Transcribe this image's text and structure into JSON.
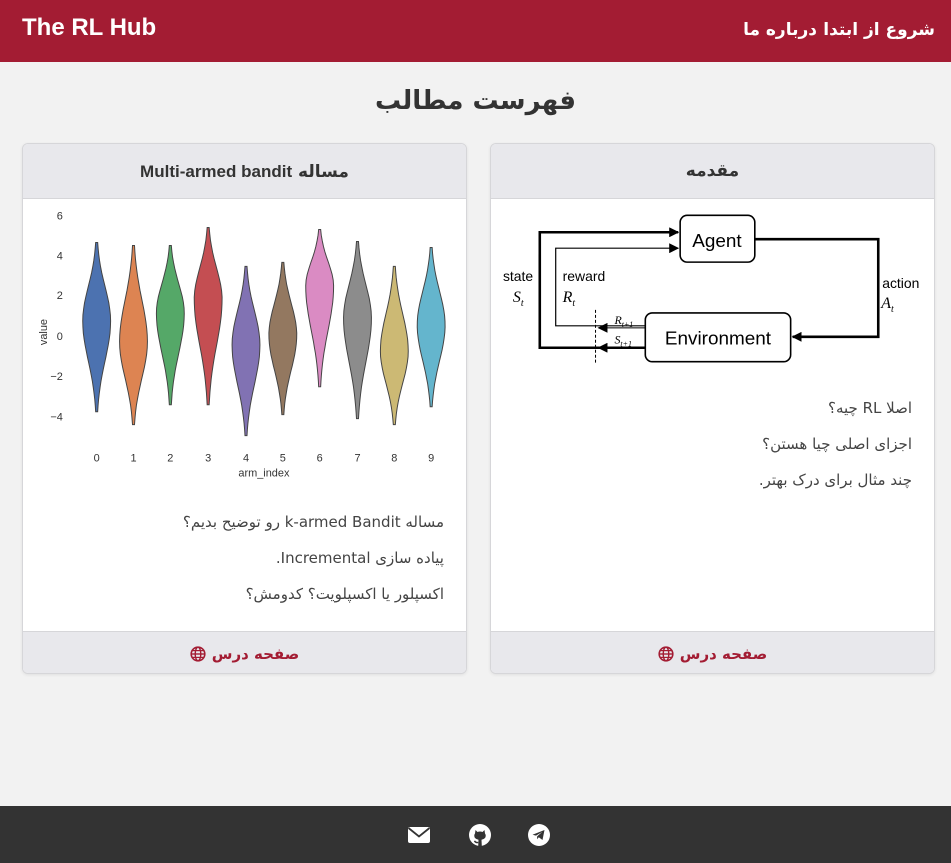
{
  "navbar": {
    "brand": "The RL Hub",
    "links": [
      {
        "label": "شروع از ابتدا"
      },
      {
        "label": "درباره ما"
      }
    ]
  },
  "page_title": "فهرست مطالب",
  "cards": [
    {
      "header_prefix": "مساله",
      "header_main": "Multi-armed bandit",
      "lines": [
        "مساله k-armed Bandit رو توضیح بدیم؟",
        "پیاده سازی Incremental.",
        "اکسپلور یا اکسپلویت؟ کدومش؟"
      ],
      "footer_label": "صفحه درس",
      "footer_icon": "globe-icon",
      "image": {
        "ylabel": "value",
        "xlabel": "arm_index",
        "yticks": [
          "6",
          "4",
          "2",
          "0",
          "−2",
          "−4"
        ],
        "xticks": [
          "0",
          "1",
          "2",
          "3",
          "4",
          "5",
          "6",
          "7",
          "8",
          "9"
        ],
        "colors": [
          "#4c72b0",
          "#dd8452",
          "#55a868",
          "#c44e52",
          "#8172b3",
          "#937860",
          "#da8bc3",
          "#8c8c8c",
          "#ccb974",
          "#64b5cd"
        ]
      }
    },
    {
      "header": "مقدمه",
      "lines": [
        "اصلا RL چیه؟",
        "اجزای اصلی چیا هستن؟",
        "چند مثال برای درک بهتر."
      ],
      "footer_label": "صفحه درس",
      "footer_icon": "globe-icon",
      "image": {
        "agent": "Agent",
        "environment": "Environment",
        "state": "state",
        "state_sym": "S",
        "state_sub": "t",
        "reward": "reward",
        "reward_sym": "R",
        "reward_sub": "t",
        "action": "action",
        "action_sym": "A",
        "action_sub": "t",
        "next_reward_sym": "R",
        "next_reward_sub": "t+1",
        "next_state_sym": "S",
        "next_state_sub": "t+1"
      }
    }
  ],
  "footer": {
    "icons": [
      "envelope-icon",
      "github-icon",
      "telegram-icon"
    ]
  }
}
